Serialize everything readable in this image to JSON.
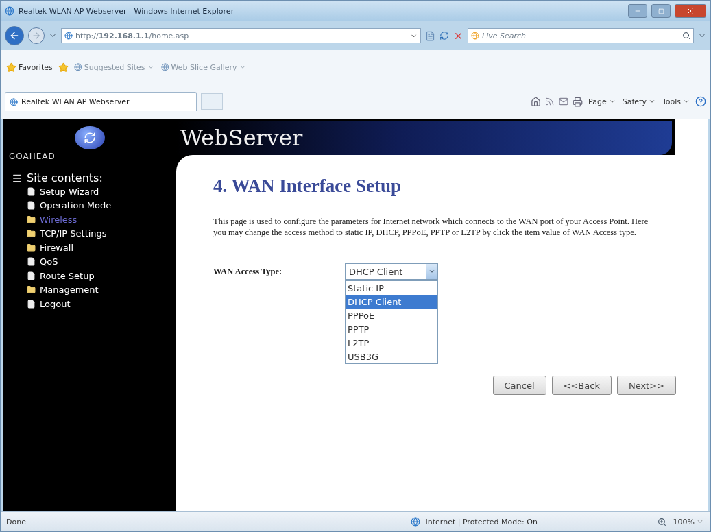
{
  "window": {
    "title": "Realtek WLAN AP Webserver - Windows Internet Explorer"
  },
  "address_bar": {
    "url": "http://**192.168.1.1**/home.asp"
  },
  "search": {
    "placeholder": "Live Search"
  },
  "favorites_bar": {
    "label": "Favorites",
    "links": [
      {
        "label": "Suggested Sites"
      },
      {
        "label": "Web Slice Gallery"
      }
    ]
  },
  "tab": {
    "label": "Realtek WLAN AP Webserver"
  },
  "command_bar": [
    "Page",
    "Safety",
    "Tools"
  ],
  "logo": {
    "text": "GOAHEAD"
  },
  "banner": {
    "title": "WebServer"
  },
  "sidebar": {
    "heading": "Site contents:",
    "items": [
      {
        "label": "Setup Wizard",
        "kind": "page",
        "selected": false
      },
      {
        "label": "Operation Mode",
        "kind": "page",
        "selected": false
      },
      {
        "label": "Wireless",
        "kind": "folder",
        "selected": true
      },
      {
        "label": "TCP/IP Settings",
        "kind": "folder",
        "selected": false
      },
      {
        "label": "Firewall",
        "kind": "folder",
        "selected": false
      },
      {
        "label": "QoS",
        "kind": "page",
        "selected": false
      },
      {
        "label": "Route Setup",
        "kind": "page",
        "selected": false
      },
      {
        "label": "Management",
        "kind": "folder",
        "selected": false
      },
      {
        "label": "Logout",
        "kind": "page",
        "selected": false
      }
    ]
  },
  "page": {
    "heading": "4. WAN Interface Setup",
    "description": "This page is used to configure the parameters for Internet network which connects to the WAN port of your Access Point. Here you may change the access method to static IP, DHCP, PPPoE, PPTP or L2TP by click the item value of WAN Access type.",
    "field": {
      "label": "WAN Access Type:",
      "value": "DHCP Client",
      "options": [
        {
          "label": "Static IP",
          "selected": false
        },
        {
          "label": "DHCP Client",
          "selected": true
        },
        {
          "label": "PPPoE",
          "selected": false
        },
        {
          "label": "PPTP",
          "selected": false
        },
        {
          "label": "L2TP",
          "selected": false
        },
        {
          "label": "USB3G",
          "selected": false
        }
      ]
    },
    "buttons": [
      "Cancel",
      "<<Back",
      "Next>>"
    ]
  },
  "status_bar": {
    "status": "Done",
    "zone": "Internet | Protected Mode: On",
    "zoom": "100%"
  }
}
